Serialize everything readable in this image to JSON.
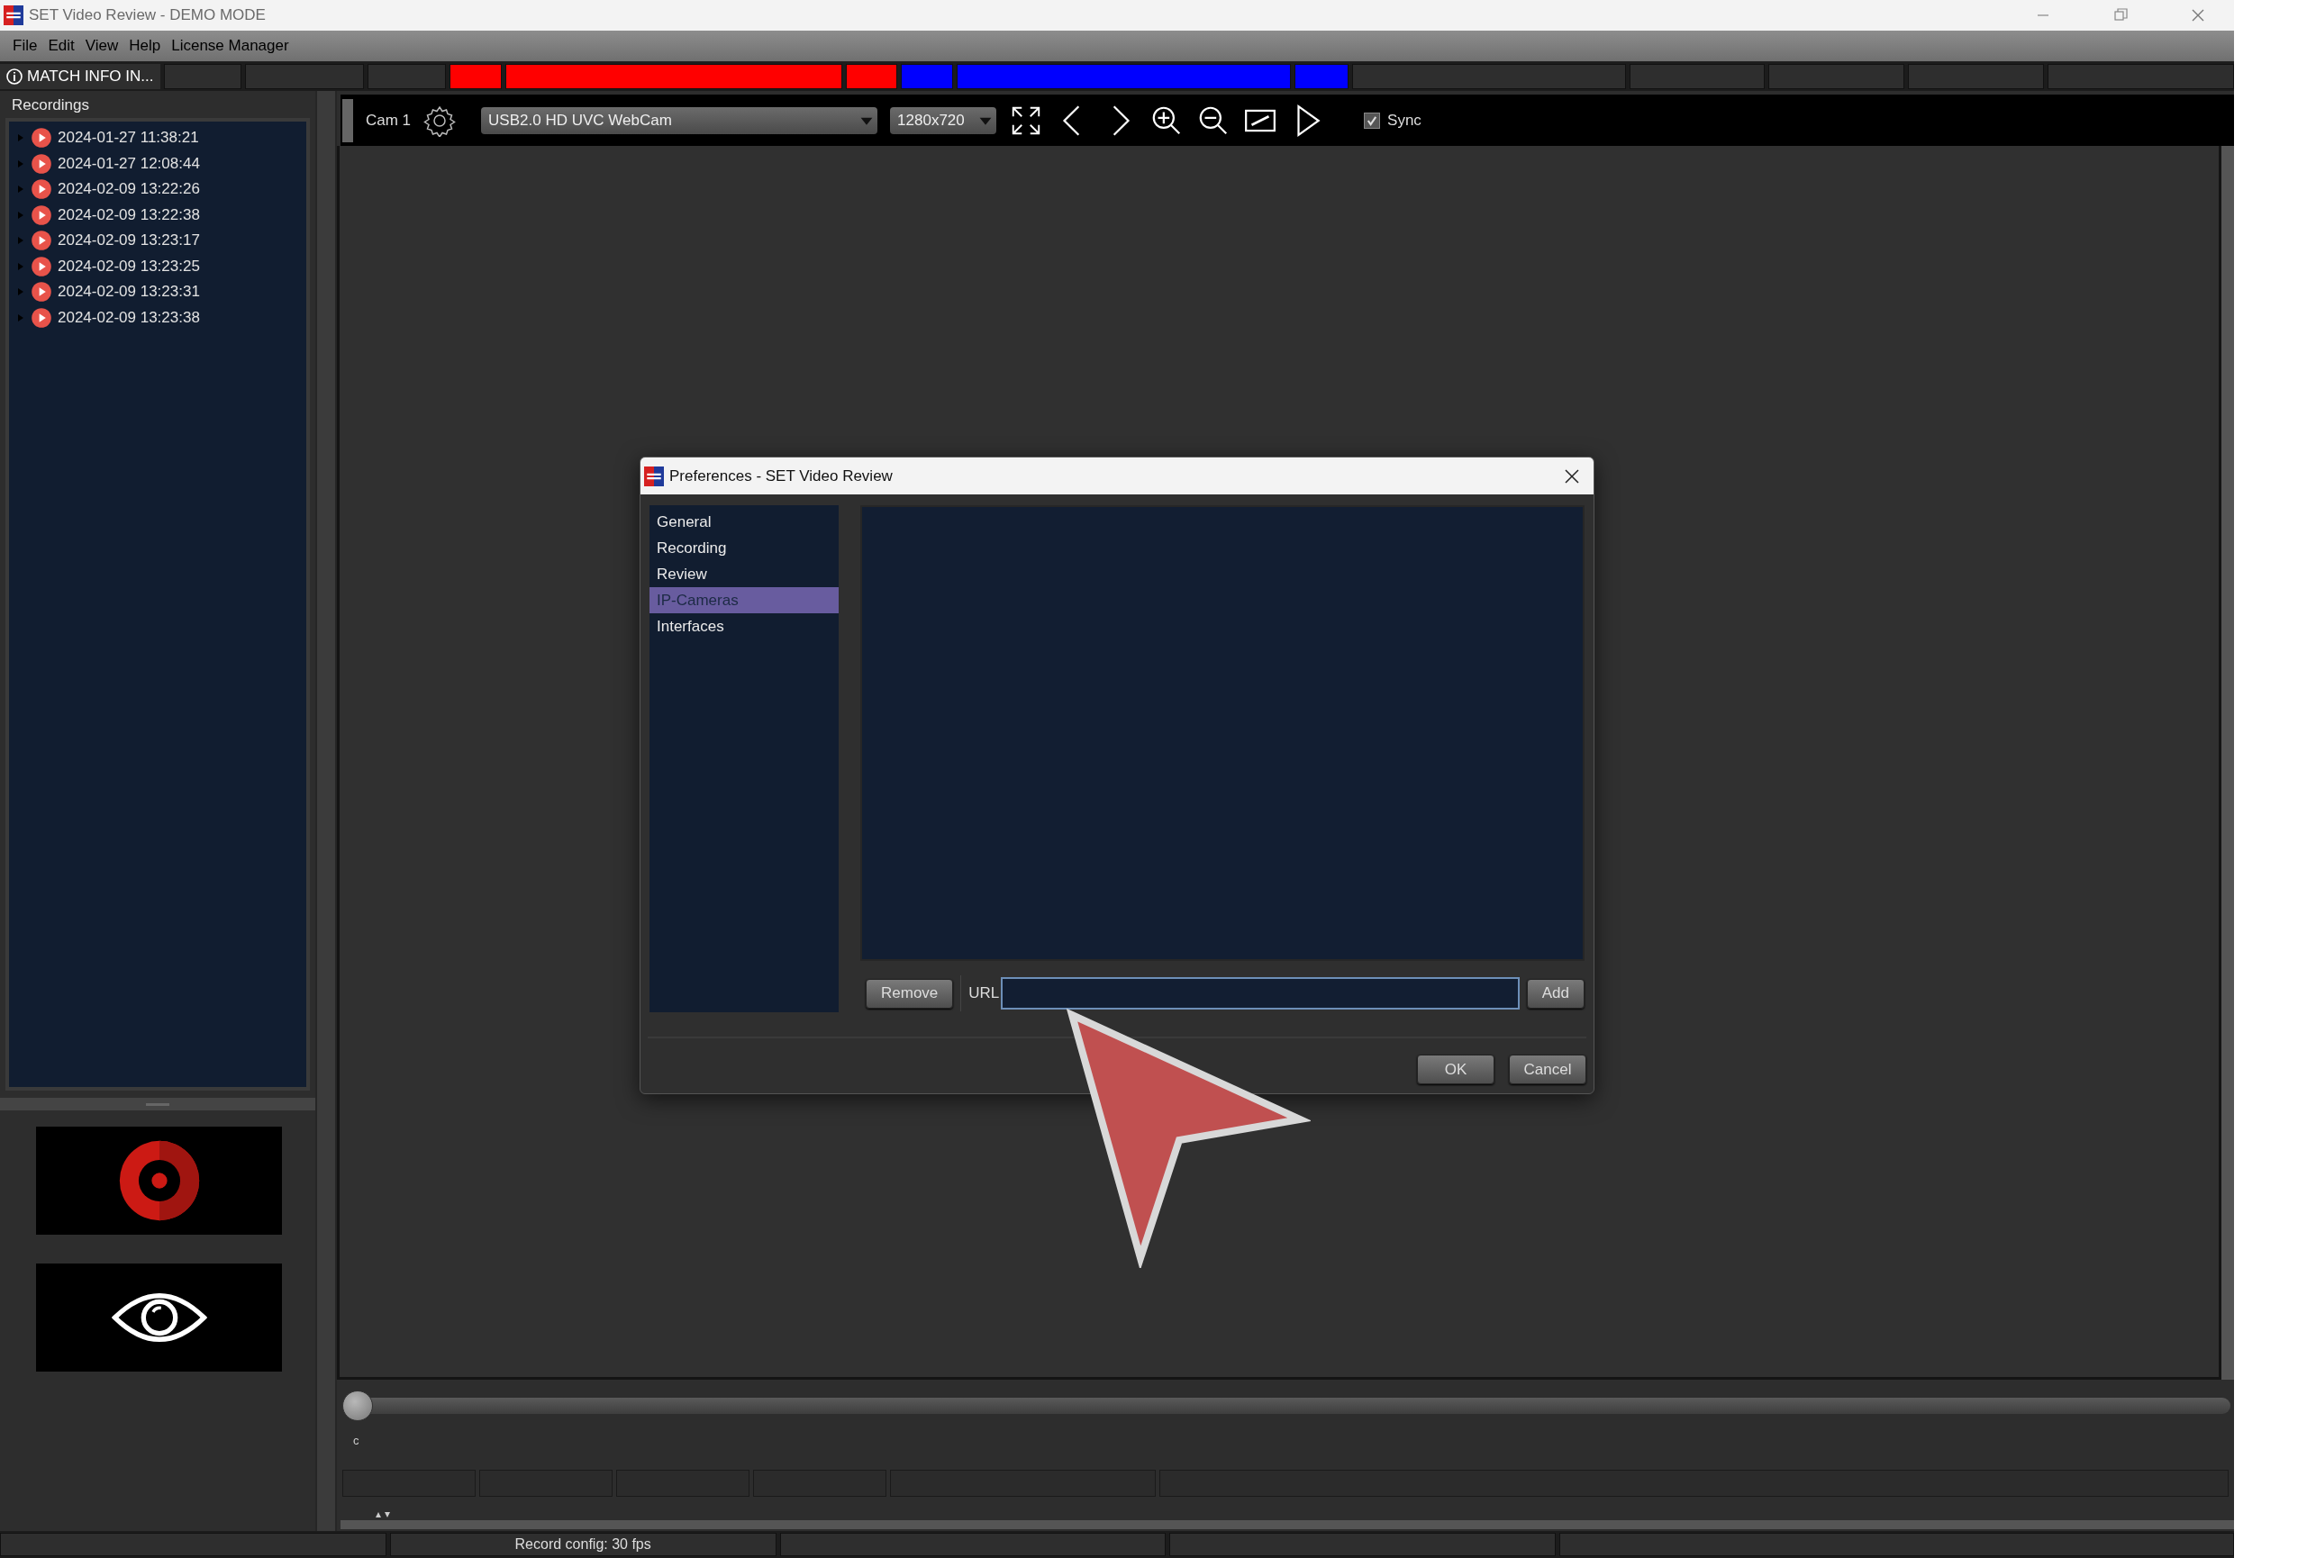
{
  "window": {
    "title": "SET Video Review - DEMO MODE"
  },
  "menu": [
    "File",
    "Edit",
    "View",
    "Help",
    "License Manager"
  ],
  "match_bar": {
    "label": "MATCH INFO IN...",
    "segments": [
      {
        "color": "#2e2e2e"
      },
      {
        "color": "#2e2e2e"
      },
      {
        "color": "#2e2e2e"
      },
      {
        "color": "#ff0000"
      },
      {
        "color": "#ff0000"
      },
      {
        "color": "#ff0000"
      },
      {
        "color": "#0000ff"
      },
      {
        "color": "#0000ff"
      },
      {
        "color": "#0000ff"
      },
      {
        "color": "#2e2e2e"
      },
      {
        "color": "#2e2e2e"
      },
      {
        "color": "#2e2e2e"
      },
      {
        "color": "#2e2e2e"
      },
      {
        "color": "#2e2e2e"
      }
    ]
  },
  "recordings": {
    "title": "Recordings",
    "items": [
      {
        "label": "2024-01-27 11:38:21",
        "expanded": false
      },
      {
        "label": "2024-01-27 12:08:44",
        "expanded": false
      },
      {
        "label": "2024-02-09 13:22:26",
        "expanded": false
      },
      {
        "label": "2024-02-09 13:22:38",
        "expanded": false
      },
      {
        "label": "2024-02-09 13:23:17",
        "expanded": false
      },
      {
        "label": "2024-02-09 13:23:25",
        "expanded": false
      },
      {
        "label": "2024-02-09 13:23:31",
        "expanded": false
      },
      {
        "label": "2024-02-09 13:23:38",
        "expanded": false
      }
    ]
  },
  "toolbar": {
    "camera_label": "Cam 1",
    "camera": "USB2.0 HD UVC WebCam",
    "resolution": "1280x720",
    "sync": {
      "label": "Sync",
      "checked": true
    }
  },
  "timeline": {
    "level": 0,
    "label": "c"
  },
  "status_bar": {
    "text": "Record config: 30 fps"
  },
  "dialog": {
    "title": "Preferences - SET Video Review",
    "nav": [
      {
        "label": "General",
        "selected": false
      },
      {
        "label": "Recording",
        "selected": false
      },
      {
        "label": "Review",
        "selected": false
      },
      {
        "label": "IP-Cameras",
        "selected": true
      },
      {
        "label": "Interfaces",
        "selected": false
      }
    ],
    "remove": "Remove",
    "url_label": "URL",
    "add": "Add",
    "ok": "OK",
    "cancel": "Cancel"
  }
}
